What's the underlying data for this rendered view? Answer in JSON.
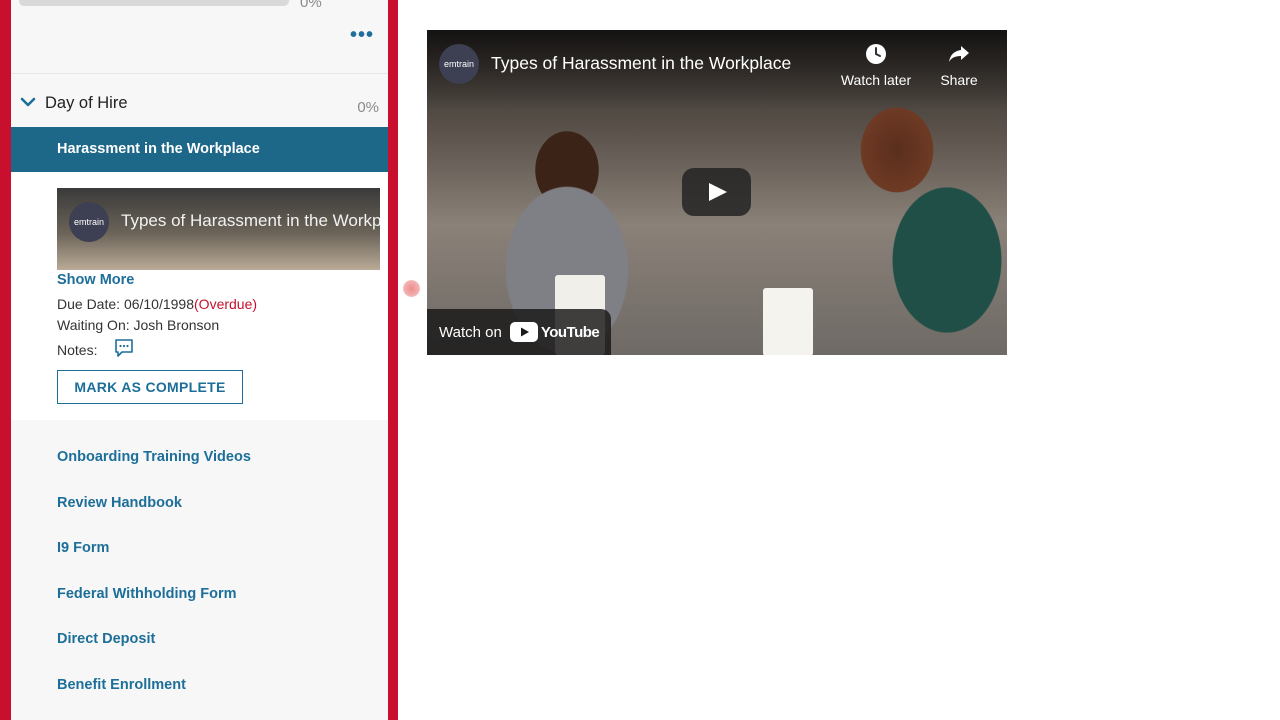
{
  "sidebar": {
    "top_progress_pct": "0%",
    "more_label": "•••",
    "section": {
      "title": "Day of Hire",
      "progress": "0%"
    },
    "active_item": "Harassment in the Workplace",
    "detail": {
      "thumbnail_logo": "emtrain",
      "thumbnail_title": "Types of Harassment in the Workplace",
      "show_more": "Show More",
      "due_label": "Due Date:",
      "due_value": "06/10/1998",
      "due_status": "(Overdue)",
      "waiting_label": "Waiting On:",
      "waiting_value": "Josh Bronson",
      "notes_label": "Notes:",
      "mark_complete": "MARK AS COMPLETE"
    },
    "tasks": [
      "Onboarding Training Videos",
      "Review Handbook",
      "I9 Form",
      "Federal Withholding Form",
      "Direct Deposit",
      "Benefit Enrollment"
    ]
  },
  "video": {
    "logo": "emtrain",
    "title": "Types of Harassment in the Workplace",
    "watch_later": "Watch later",
    "share": "Share",
    "watch_on": "Watch on",
    "youtube": "YouTube"
  },
  "colors": {
    "frame_red": "#c8102e",
    "accent_blue": "#1d6f99",
    "active_bg": "#1d6788",
    "overdue_red": "#c8102e"
  }
}
